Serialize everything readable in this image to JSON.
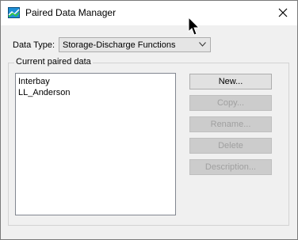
{
  "window": {
    "title": "Paired Data Manager"
  },
  "data_type": {
    "label": "Data Type:",
    "selected": "Storage-Discharge Functions"
  },
  "group": {
    "label": "Current paired data"
  },
  "list": {
    "items": [
      "Interbay",
      "LL_Anderson"
    ]
  },
  "buttons": {
    "new": "New...",
    "copy": "Copy...",
    "rename": "Rename...",
    "delete": "Delete",
    "description": "Description..."
  },
  "icons": {
    "app": "paired-data-icon",
    "close": "close-icon",
    "dropdown": "chevron-down-icon",
    "cursor": "mouse-cursor-icon"
  }
}
